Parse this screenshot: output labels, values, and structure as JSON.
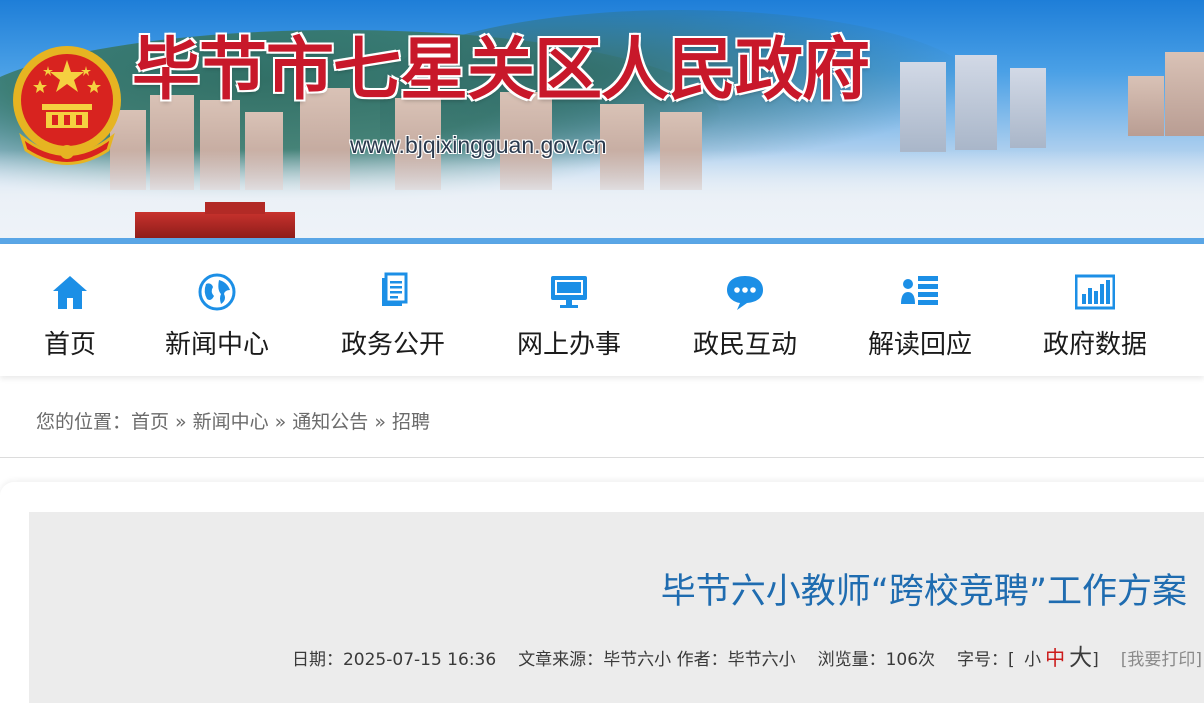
{
  "header": {
    "site_title": "毕节市七星关区人民政府",
    "site_url": "www.bjqixingguan.gov.cn",
    "emblem": "national-emblem"
  },
  "nav": {
    "items": [
      {
        "label": "首页",
        "icon": "home-icon"
      },
      {
        "label": "新闻中心",
        "icon": "globe-icon"
      },
      {
        "label": "政务公开",
        "icon": "document-icon"
      },
      {
        "label": "网上办事",
        "icon": "monitor-icon"
      },
      {
        "label": "政民互动",
        "icon": "chat-bubble-icon"
      },
      {
        "label": "解读回应",
        "icon": "user-list-icon"
      },
      {
        "label": "政府数据",
        "icon": "bar-chart-icon"
      }
    ]
  },
  "breadcrumb": {
    "prefix": "您的位置：",
    "items": [
      "首页",
      "新闻中心",
      "通知公告",
      "招聘"
    ],
    "separator": "»"
  },
  "article": {
    "title": "毕节六小教师“跨校竞聘”工作方案",
    "date_label": "日期：",
    "date": "2025-07-15 16:36",
    "source_label": "文章来源：",
    "source": "毕节六小",
    "author_label": "作者：",
    "author": "毕节六小",
    "views_label": "浏览量：",
    "views": "106次",
    "font_size_label": "字号：[",
    "font_small": "小",
    "font_medium": "中",
    "font_large": "大",
    "font_close": "]",
    "print_label": "[我要打印]"
  },
  "colors": {
    "title_red": "#c8182a",
    "nav_icon_blue": "#1c8fe6",
    "article_title_blue": "#1f6cb0",
    "accent_line": "#5aa6e6"
  }
}
